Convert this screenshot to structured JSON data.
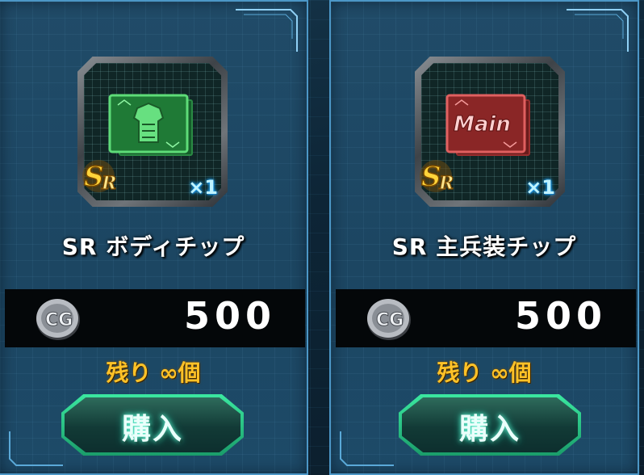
{
  "colors": {
    "card_border": "#4c97c7",
    "card_bg": "#1f4865",
    "stock_text": "#ffc227",
    "button_glow": "#3be8a0",
    "qty_glow": "#1ea8ff"
  },
  "items": [
    {
      "name": "SR ボディチップ",
      "rarity_icon": "sr-rarity-badge-icon",
      "chip_icon": "body-armor-chip-icon",
      "chip_color": "#3fbf5a",
      "quantity": "×1",
      "currency_icon": "cg-coin-icon",
      "price": "500",
      "stock": "残り ∞個",
      "buy_label": "購入"
    },
    {
      "name": "SR 主兵装チップ",
      "rarity_icon": "sr-rarity-badge-icon",
      "chip_icon": "main-weapon-chip-icon",
      "chip_color": "#c23b3b",
      "chip_text": "Main",
      "quantity": "×1",
      "currency_icon": "cg-coin-icon",
      "price": "500",
      "stock": "残り ∞個",
      "buy_label": "購入"
    }
  ]
}
